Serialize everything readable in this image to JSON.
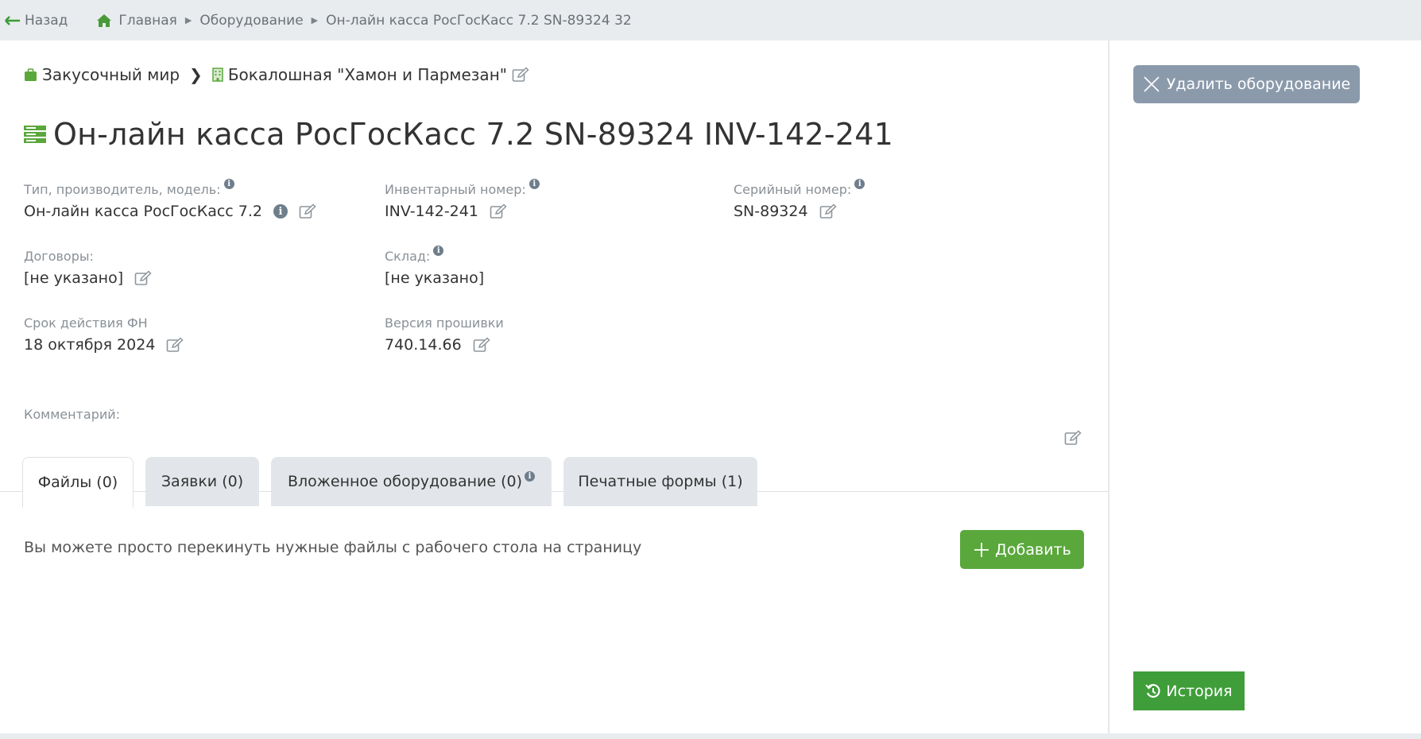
{
  "topbar": {
    "back_label": "Назад",
    "breadcrumbs": [
      "Главная",
      "Оборудование",
      "Он-лайн касса РосГосКасс 7.2 SN-89324 32"
    ]
  },
  "location": {
    "client": "Закусочный мир",
    "object": "Бокалошная \"Хамон и Пармезан\""
  },
  "title": "Он-лайн касса РосГосКасс 7.2 SN-89324 INV-142-241",
  "fields": {
    "type_label": "Тип, производитель, модель:",
    "type_value": "Он-лайн касса РосГосКасс 7.2",
    "inv_label": "Инвентарный номер:",
    "inv_value": "INV-142-241",
    "serial_label": "Серийный номер:",
    "serial_value": "SN-89324",
    "contracts_label": "Договоры:",
    "contracts_value": "[не указано]",
    "warehouse_label": "Склад:",
    "warehouse_value": "[не указано]",
    "fn_label": "Срок действия ФН",
    "fn_value": "18 октября 2024",
    "firmware_label": "Версия прошивки",
    "firmware_value": "740.14.66",
    "comment_label": "Комментарий:"
  },
  "tabs": [
    {
      "label": "Файлы (0)",
      "active": true
    },
    {
      "label": "Заявки (0)",
      "active": false
    },
    {
      "label": "Вложенное оборудование (0)",
      "active": false
    },
    {
      "label": "Печатные формы (1)",
      "active": false
    }
  ],
  "files": {
    "hint": "Вы можете просто перекинуть нужные файлы с рабочего стола на страницу",
    "add_label": "Добавить"
  },
  "sidebar": {
    "delete_label": "Удалить оборудование",
    "history_label": "История"
  },
  "colors": {
    "accent_green": "#5aa83c",
    "history_green": "#3f9e3a",
    "delete_gray": "#8b9aab"
  }
}
